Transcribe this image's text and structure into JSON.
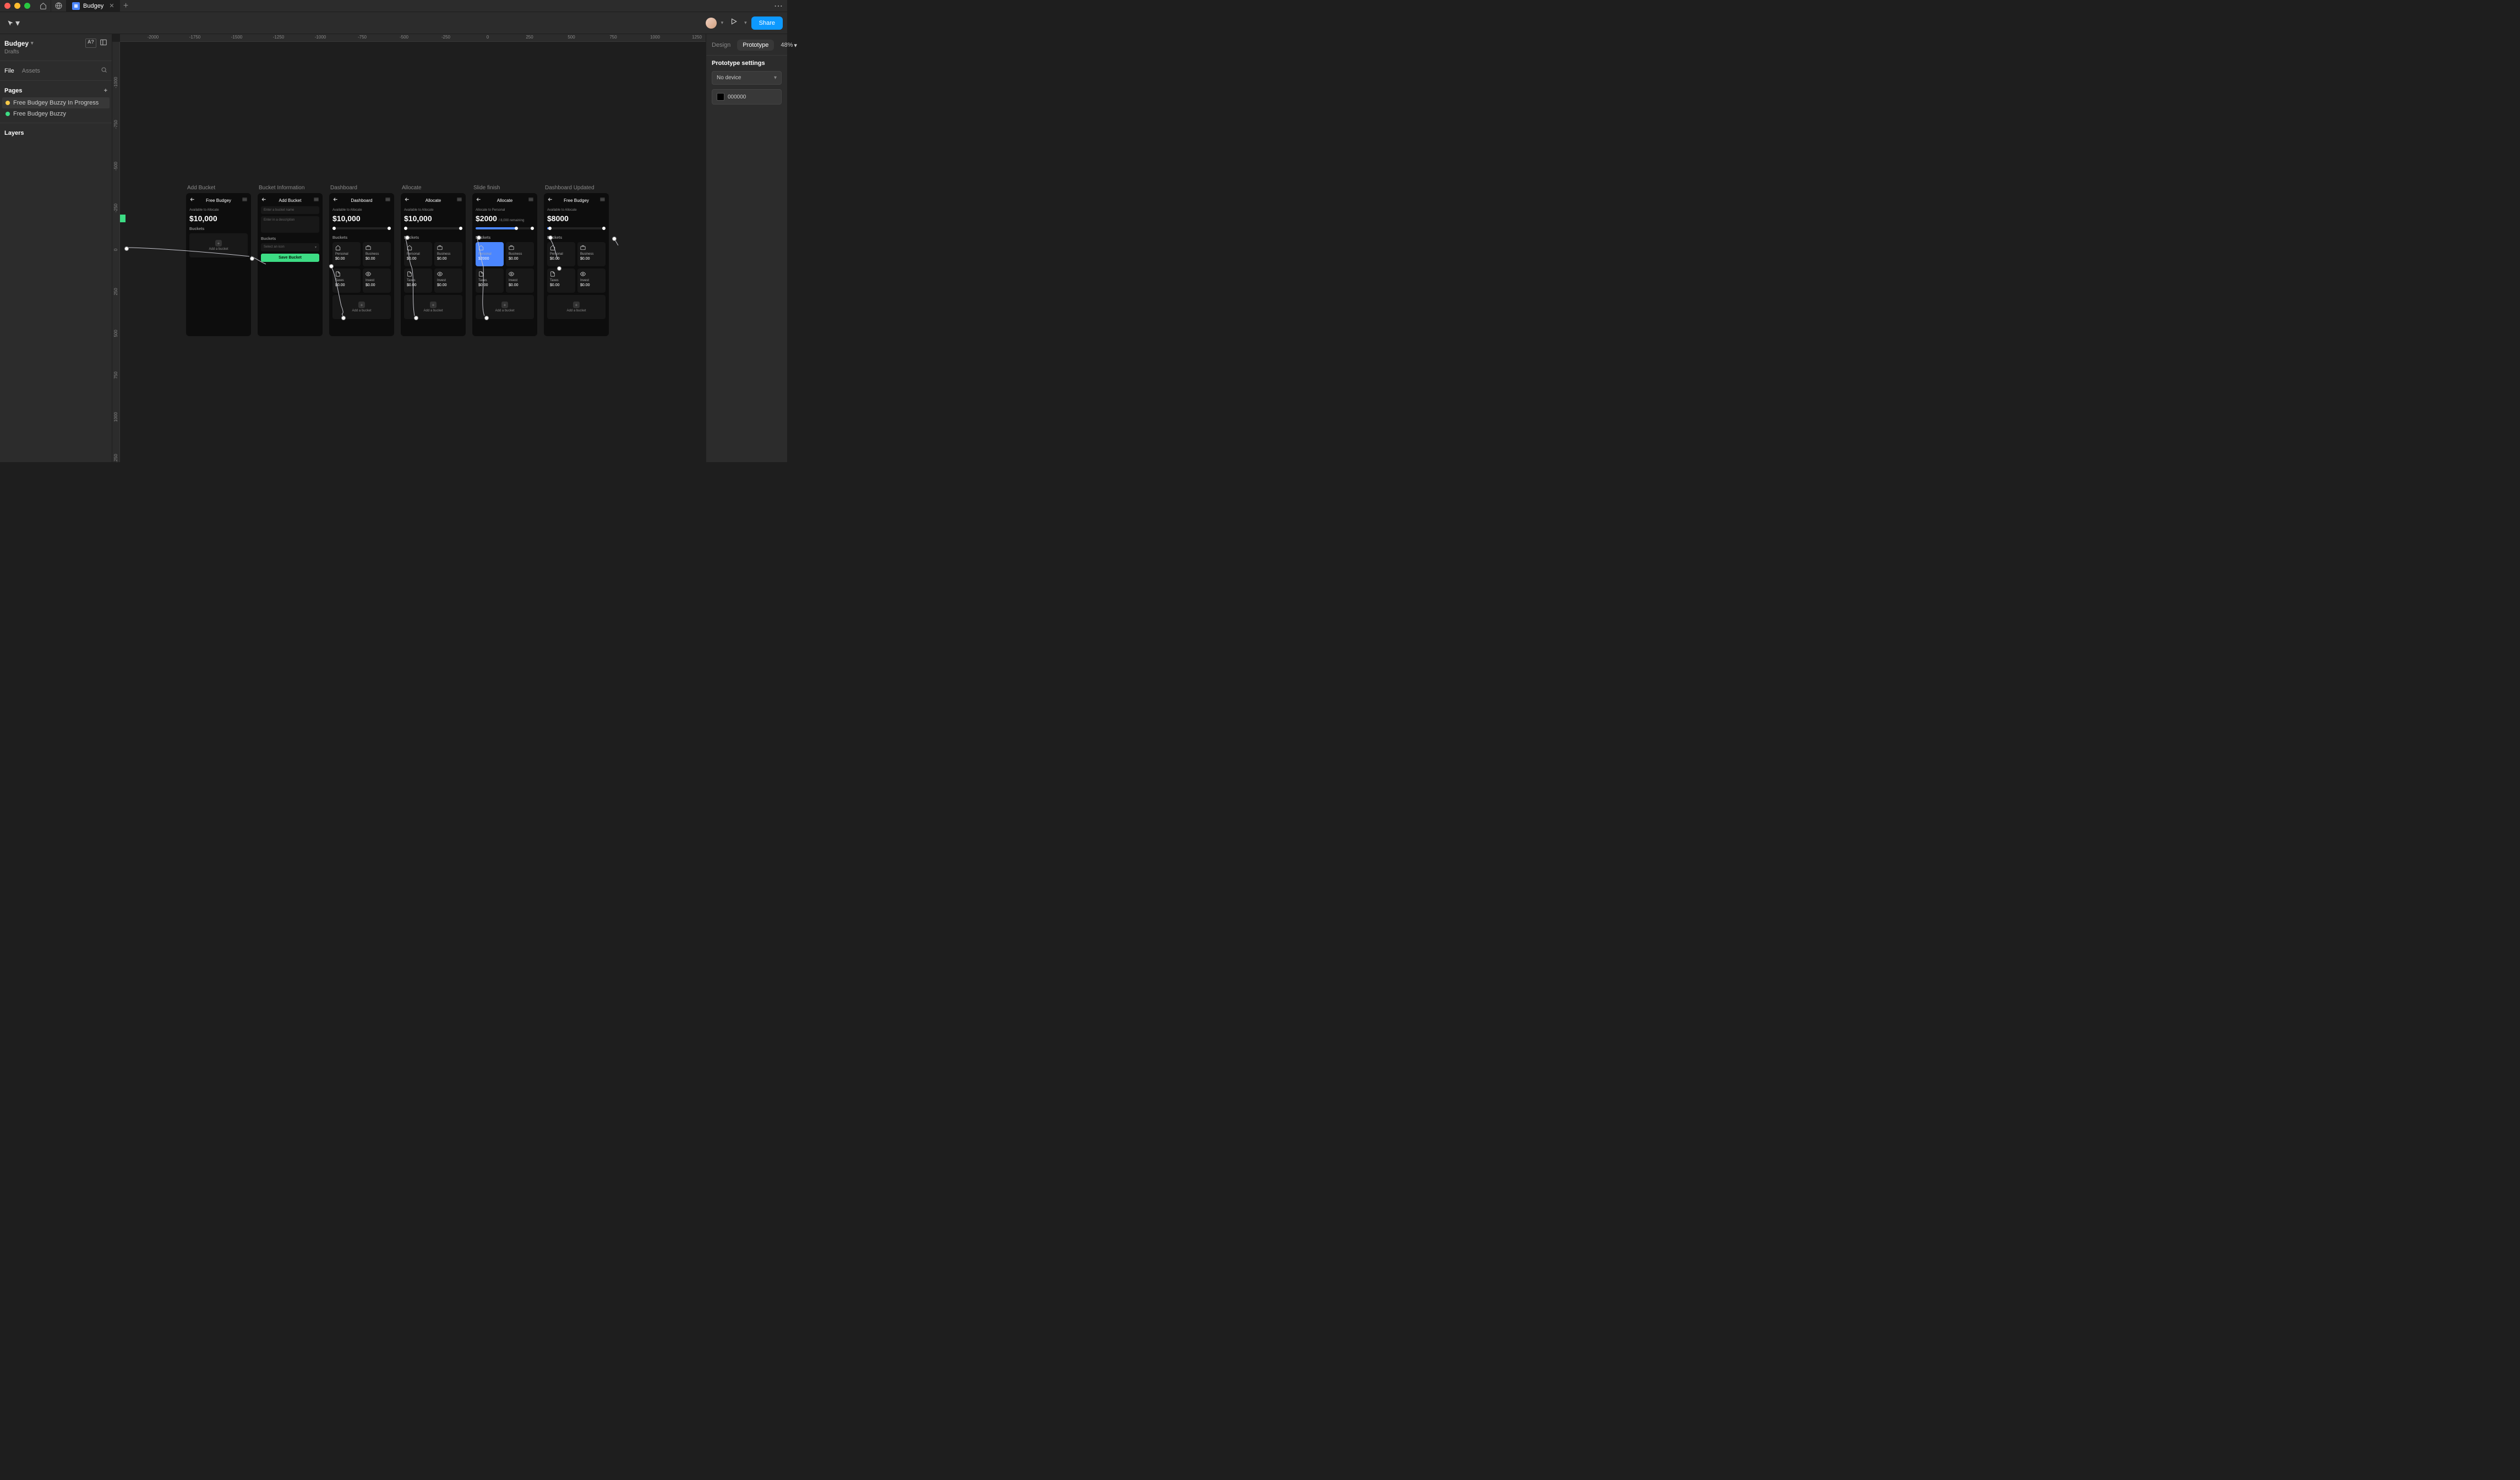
{
  "titlebar": {
    "tab_name": "Budgey"
  },
  "toolbar": {
    "share_label": "Share"
  },
  "left_panel": {
    "project_name": "Budgey",
    "project_sub": "Drafts",
    "tabs": {
      "file": "File",
      "assets": "Assets"
    },
    "pages_label": "Pages",
    "pages": [
      {
        "name": "Free Budgey Buzzy In Progress",
        "dot": "yellow",
        "selected": true
      },
      {
        "name": "Free Budgey Buzzy",
        "dot": "green",
        "selected": false
      }
    ],
    "layers_label": "Layers"
  },
  "right_panel": {
    "tabs": {
      "design": "Design",
      "prototype": "Prototype"
    },
    "zoom": "48%",
    "section_title": "Prototype settings",
    "device": "No device",
    "color": "000000"
  },
  "ruler_h": [
    "-2000",
    "-1750",
    "-1500",
    "-1250",
    "-1000",
    "-750",
    "-500",
    "-250",
    "0",
    "250",
    "500",
    "750",
    "1000",
    "1250"
  ],
  "ruler_v": [
    "-1000",
    "-750",
    "-500",
    "-250",
    "0",
    "250",
    "500",
    "750",
    "1000",
    "1250"
  ],
  "frames": [
    {
      "label": "Add Bucket",
      "header_title": "Free Budgey",
      "avail_label": "Available to Allocate",
      "amount": "$10,000",
      "buckets_label": "Buckets",
      "add_bucket_label": "Add a bucket"
    },
    {
      "label": "Bucket Information",
      "header_title": "Add Bucket",
      "name_placeholder": "Enter a bucket name",
      "desc_placeholder": "Enter in a description",
      "buckets_label": "Buckets",
      "select_icon_label": "Select an icon",
      "save_label": "Save Bucket"
    },
    {
      "label": "Dashboard",
      "header_title": "Dashboard",
      "avail_label": "Available to Allocate",
      "amount": "$10,000",
      "buckets_label": "Buckets",
      "cards": [
        {
          "icon": "home",
          "name": "Personal",
          "val": "$0.00"
        },
        {
          "icon": "briefcase",
          "name": "Business",
          "val": "$0.00"
        },
        {
          "icon": "doc",
          "name": "Taxes",
          "val": "$0.00"
        },
        {
          "icon": "eye",
          "name": "Invest",
          "val": "$0.00"
        }
      ],
      "add_bucket_label": "Add a bucket",
      "slider_fill": 0
    },
    {
      "label": "Allocate",
      "header_title": "Allocate",
      "avail_label": "Available to Allocate",
      "amount": "$10,000",
      "buckets_label": "Buckets",
      "cards": [
        {
          "icon": "home",
          "name": "Personal",
          "val": "$0.00"
        },
        {
          "icon": "briefcase",
          "name": "Business",
          "val": "$0.00"
        },
        {
          "icon": "doc",
          "name": "Taxes",
          "val": "$0.00"
        },
        {
          "icon": "eye",
          "name": "Invest",
          "val": "$0.00"
        }
      ],
      "add_bucket_label": "Add a bucket",
      "slider_fill": 0
    },
    {
      "label": "Slide finish",
      "header_title": "Allocate",
      "avail_label": "Allocate to Personal",
      "amount": "$2000",
      "remaining": "/ 8,000 remaining",
      "buckets_label": "Buckets",
      "cards": [
        {
          "icon": "home",
          "name": "Personal",
          "val": "$2000",
          "selected": true
        },
        {
          "icon": "briefcase",
          "name": "Business",
          "val": "$0.00"
        },
        {
          "icon": "doc",
          "name": "Taxes",
          "val": "$0.00"
        },
        {
          "icon": "eye",
          "name": "Invest",
          "val": "$0.00"
        }
      ],
      "add_bucket_label": "Add a bucket",
      "slider_fill": 70
    },
    {
      "label": "Dashboard Updated",
      "header_title": "Free Budgey",
      "avail_label": "Available to Allocate",
      "amount": "$8000",
      "buckets_label": "Buckets",
      "cards": [
        {
          "icon": "home",
          "name": "Personal",
          "val": "$0.00"
        },
        {
          "icon": "briefcase",
          "name": "Business",
          "val": "$0.00"
        },
        {
          "icon": "doc",
          "name": "Taxes",
          "val": "$0.00"
        },
        {
          "icon": "eye",
          "name": "Invest",
          "val": "$0.00"
        }
      ],
      "add_bucket_label": "Add a bucket",
      "slider_fill": 5
    }
  ]
}
